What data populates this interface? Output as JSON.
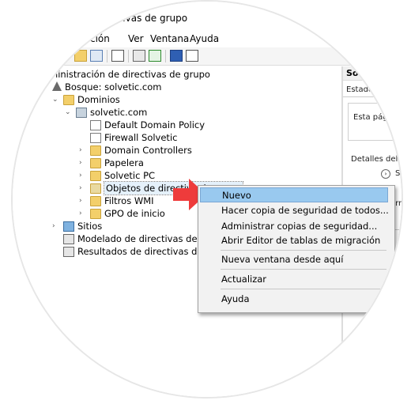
{
  "window": {
    "title": "ctivas de grupo"
  },
  "menu": [
    "ción",
    "Ver",
    "Ventana",
    "Ayuda"
  ],
  "tree": {
    "root": "ministración de directivas de grupo",
    "forest": "Bosque: solvetic.com",
    "domains": "Dominios",
    "domain": "solvetic.com",
    "items": [
      "Default Domain Policy",
      "Firewall Solvetic",
      "Domain Controllers",
      "Papelera",
      "Solvetic PC",
      "Objetos de directiva de grupo",
      "Filtros WMI",
      "GPO de inicio"
    ],
    "sites": "Sitios",
    "modeling": "Modelado de directivas de grupo",
    "results": "Resultados de directivas de grupo"
  },
  "right_panel": {
    "header": "Solv",
    "tab": "Estado",
    "box_text": "Esta pág",
    "details": "Detalles del e",
    "s": "S",
    "forma": "orma",
    "n": "n"
  },
  "context_menu": {
    "items": [
      "Nuevo",
      "Hacer copia de seguridad de todos...",
      "Administrar copias de seguridad...",
      "Abrir Editor de tablas de migración",
      "Nueva ventana desde aquí",
      "Actualizar",
      "Ayuda"
    ],
    "highlighted": "Nuevo"
  },
  "colors": {
    "highlight": "#99c9ef",
    "arrow": "#ee3b3b",
    "folder": "#f3cf6a"
  }
}
